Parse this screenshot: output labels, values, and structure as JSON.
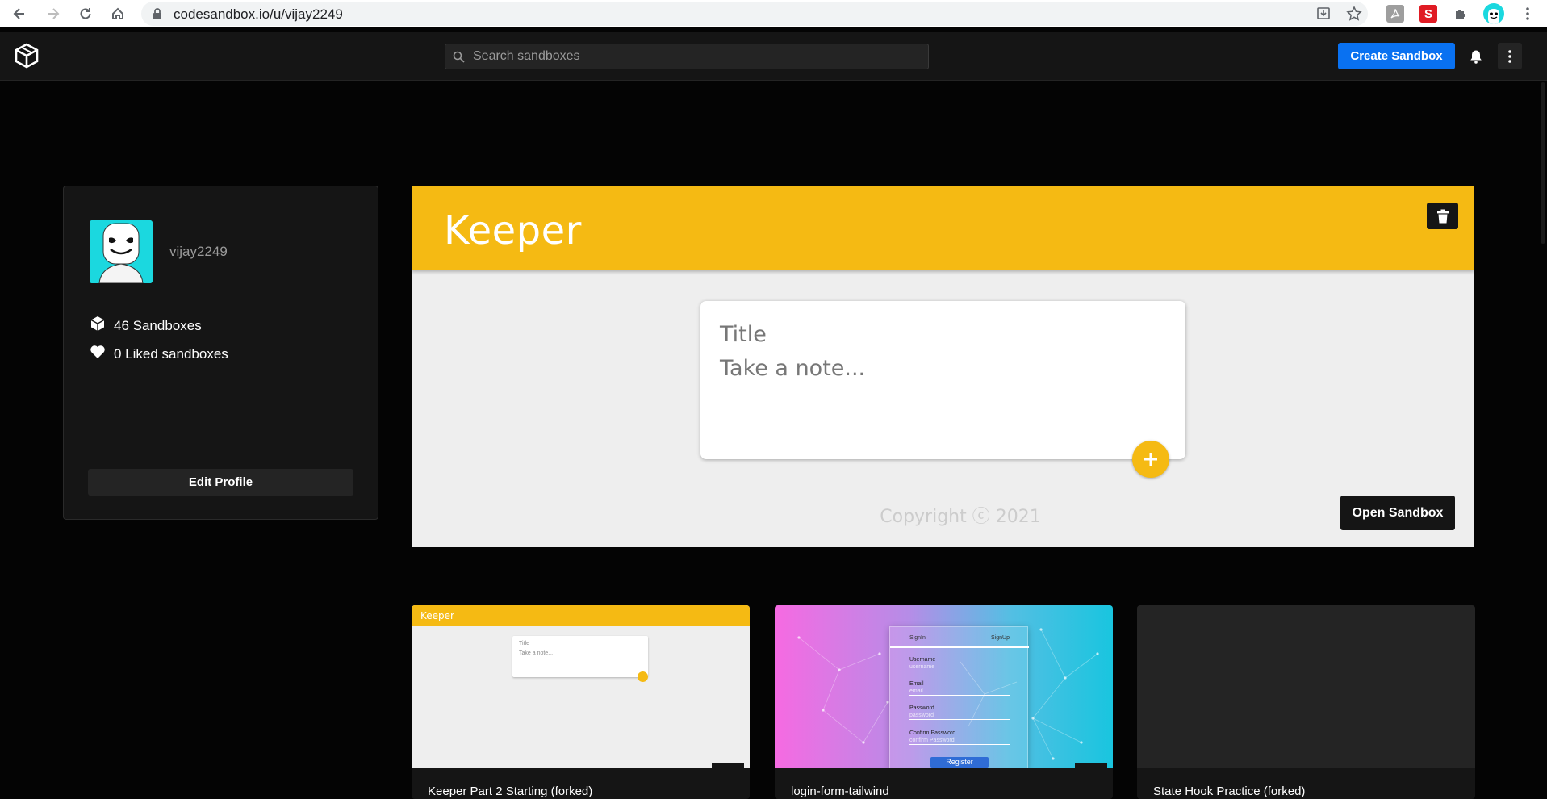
{
  "browser": {
    "url": "codesandbox.io/u/vijay2249"
  },
  "header": {
    "search_placeholder": "Search sandboxes",
    "create_label": "Create Sandbox"
  },
  "profile": {
    "username": "vijay2249",
    "sandboxes_count": "46 Sandboxes",
    "liked_count": "0 Liked sandboxes",
    "edit_label": "Edit Profile"
  },
  "featured": {
    "app_title": "Keeper",
    "note_title_placeholder": "Title",
    "note_body_placeholder": "Take a note...",
    "copyright": "Copyright ⓒ 2021",
    "open_label": "Open Sandbox"
  },
  "cards": [
    {
      "title": "Keeper Part 2 Starting (forked)",
      "thumb_banner": "Keeper",
      "thumb_note_title": "Title",
      "thumb_note_body": "Take a note..."
    },
    {
      "title": "login-form-tailwind",
      "thumb_tab_signin": "SignIn",
      "thumb_tab_signup": "SignUp",
      "thumb_fields": [
        {
          "label": "Username",
          "placeholder": "username"
        },
        {
          "label": "Email",
          "placeholder": "email"
        },
        {
          "label": "Password",
          "placeholder": "password"
        },
        {
          "label": "Confirm Password",
          "placeholder": "confirm Password"
        }
      ],
      "thumb_button": "Register"
    },
    {
      "title": "State Hook Practice (forked)"
    }
  ],
  "colors": {
    "accent_yellow": "#f5ba13",
    "primary_blue": "#0971f1",
    "background": "#040404",
    "surface": "#151515"
  }
}
